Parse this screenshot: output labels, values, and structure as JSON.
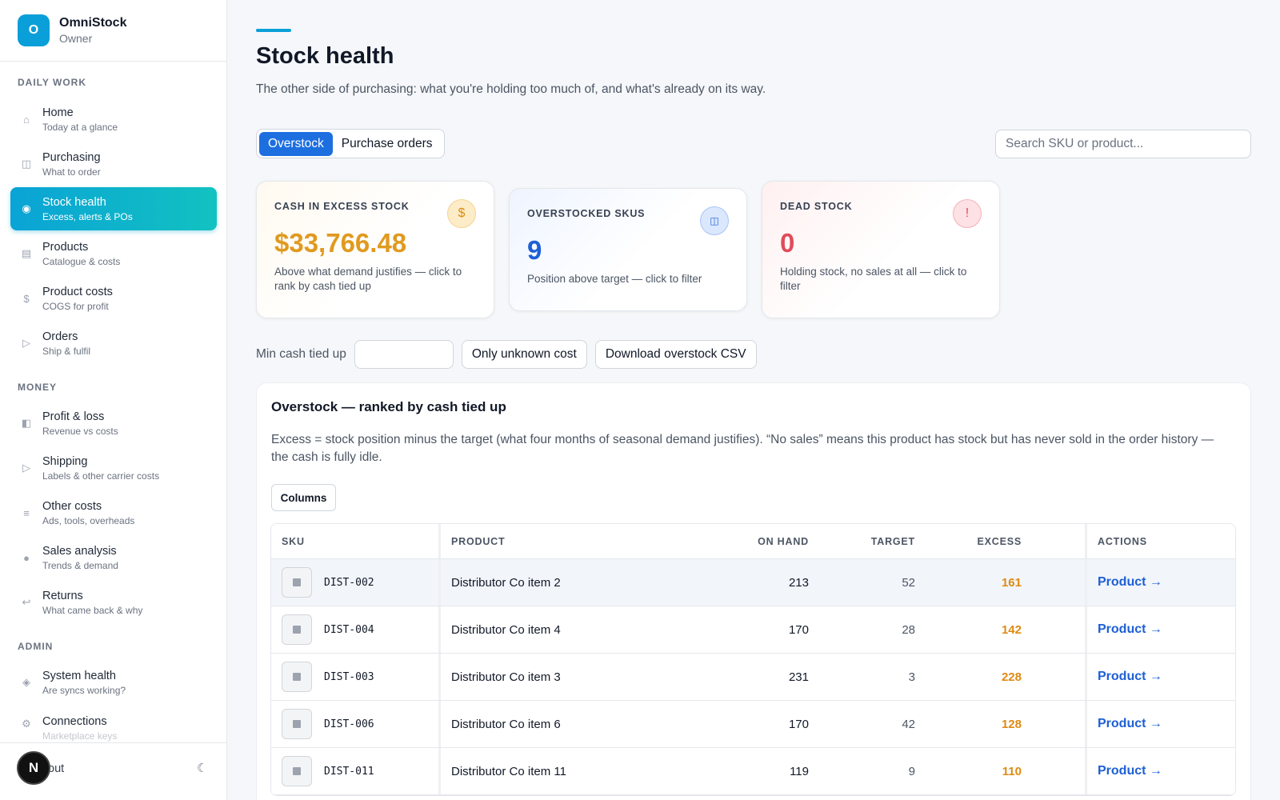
{
  "app": {
    "name": "OmniStock",
    "role": "Owner",
    "logo_letter": "O"
  },
  "sidebar": {
    "sections": {
      "daily": "DAILY WORK",
      "money": "MONEY",
      "admin": "ADMIN"
    },
    "items": [
      {
        "label": "Home",
        "sub": "Today at a glance",
        "icon": "home-icon"
      },
      {
        "label": "Purchasing",
        "sub": "What to order",
        "icon": "columns-icon"
      },
      {
        "label": "Stock health",
        "sub": "Excess, alerts & POs",
        "icon": "circle-dot-icon"
      },
      {
        "label": "Products",
        "sub": "Catalogue & costs",
        "icon": "box-icon"
      },
      {
        "label": "Product costs",
        "sub": "COGS for profit",
        "icon": "dollar-icon"
      },
      {
        "label": "Orders",
        "sub": "Ship & fulfil",
        "icon": "play-icon"
      },
      {
        "label": "Profit & loss",
        "sub": "Revenue vs costs",
        "icon": "half-square-icon"
      },
      {
        "label": "Shipping",
        "sub": "Labels & other carrier costs",
        "icon": "play-icon"
      },
      {
        "label": "Other costs",
        "sub": "Ads, tools, overheads",
        "icon": "list-icon"
      },
      {
        "label": "Sales analysis",
        "sub": "Trends & demand",
        "icon": "dot-icon"
      },
      {
        "label": "Returns",
        "sub": "What came back & why",
        "icon": "return-icon"
      },
      {
        "label": "System health",
        "sub": "Are syncs working?",
        "icon": "diamond-icon"
      },
      {
        "label": "Connections",
        "sub": "Marketplace keys",
        "icon": "gear-icon"
      }
    ],
    "footer": {
      "avatar_letter": "N",
      "logout": "out",
      "theme_icon": "☾"
    }
  },
  "page": {
    "title": "Stock health",
    "subtitle": "The other side of purchasing: what you're holding too much of, and what's already on its way."
  },
  "tabs": [
    "Overstock",
    "Purchase orders"
  ],
  "search": {
    "placeholder": "Search SKU or product..."
  },
  "cards": [
    {
      "title": "CASH IN EXCESS STOCK",
      "value": "$33,766.48",
      "desc": "Above what demand justifies — click to rank by cash tied up",
      "icon": "$"
    },
    {
      "title": "OVERSTOCKED SKUS",
      "value": "9",
      "desc": "Position above target — click to filter",
      "icon": "◫"
    },
    {
      "title": "DEAD STOCK",
      "value": "0",
      "desc": "Holding stock, no sales at all — click to filter",
      "icon": "!"
    }
  ],
  "filters": {
    "min_cash_label": "Min cash tied up",
    "unknown_cost": "Only unknown cost",
    "download": "Download overstock CSV"
  },
  "panel": {
    "title": "Overstock — ranked by cash tied up",
    "desc": "Excess = stock position minus the target (what four months of seasonal demand justifies). “No sales” means this product has stock but has never sold in the order history — the cash is fully idle.",
    "columns_btn": "Columns"
  },
  "table": {
    "headers": {
      "sku": "SKU",
      "product": "PRODUCT",
      "on_hand": "ON HAND",
      "target": "TARGET",
      "excess": "EXCESS",
      "actions": "ACTIONS"
    },
    "rows": [
      {
        "sku": "DIST-002",
        "product": "Distributor Co item 2",
        "on_hand": "213",
        "target": "52",
        "excess": "161",
        "action": "Product →"
      },
      {
        "sku": "DIST-004",
        "product": "Distributor Co item 4",
        "on_hand": "170",
        "target": "28",
        "excess": "142",
        "action": "Product →"
      },
      {
        "sku": "DIST-003",
        "product": "Distributor Co item 3",
        "on_hand": "231",
        "target": "3",
        "excess": "228",
        "action": "Product →"
      },
      {
        "sku": "DIST-006",
        "product": "Distributor Co item 6",
        "on_hand": "170",
        "target": "42",
        "excess": "128",
        "action": "Product →"
      },
      {
        "sku": "DIST-011",
        "product": "Distributor Co item 11",
        "on_hand": "119",
        "target": "9",
        "excess": "110",
        "action": "Product →"
      }
    ]
  },
  "colors": {
    "accent": "#0a9fd8",
    "tab_active": "#1d6fe0",
    "excess": "#e08a12",
    "link": "#1d5fd6"
  }
}
